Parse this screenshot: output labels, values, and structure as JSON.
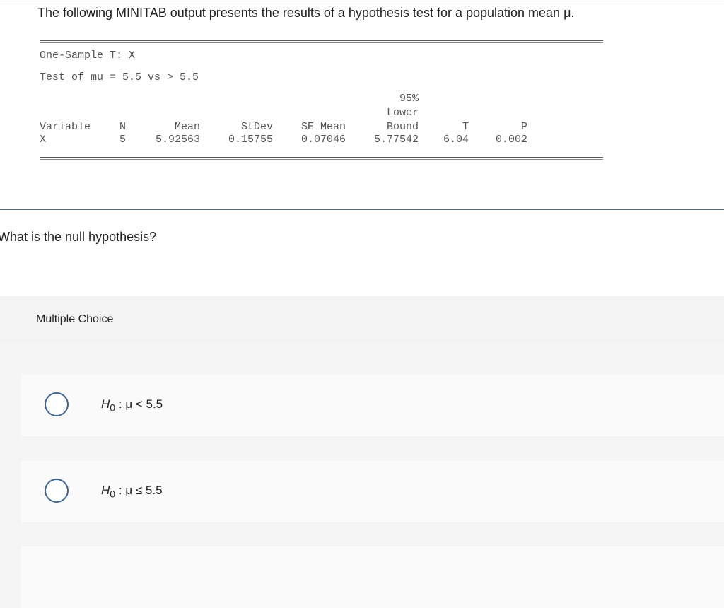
{
  "intro": "The following MINITAB output presents the results of a hypothesis test for a population mean μ.",
  "minitab": {
    "title": "One-Sample T: X",
    "test": "Test of mu = 5.5 vs > 5.5",
    "headers": {
      "variable": "Variable",
      "n": "N",
      "mean": "Mean",
      "stdev": "StDev",
      "semean": "SE Mean",
      "bound1": "95%",
      "bound2": "Lower",
      "bound3": "Bound",
      "t": "T",
      "p": "P"
    },
    "row": {
      "variable": "X",
      "n": "5",
      "mean": "5.92563",
      "stdev": "0.15755",
      "semean": "0.07046",
      "bound": "5.77542",
      "t": "6.04",
      "p": "0.002"
    }
  },
  "question": "What is the null hypothesis?",
  "section_label": "Multiple Choice",
  "options": [
    {
      "h": "H",
      "sub": "0",
      "rest": " : μ < 5.5",
      "selected": false
    },
    {
      "h": "H",
      "sub": "0",
      "rest": " : μ ≤ 5.5",
      "selected": false
    }
  ]
}
